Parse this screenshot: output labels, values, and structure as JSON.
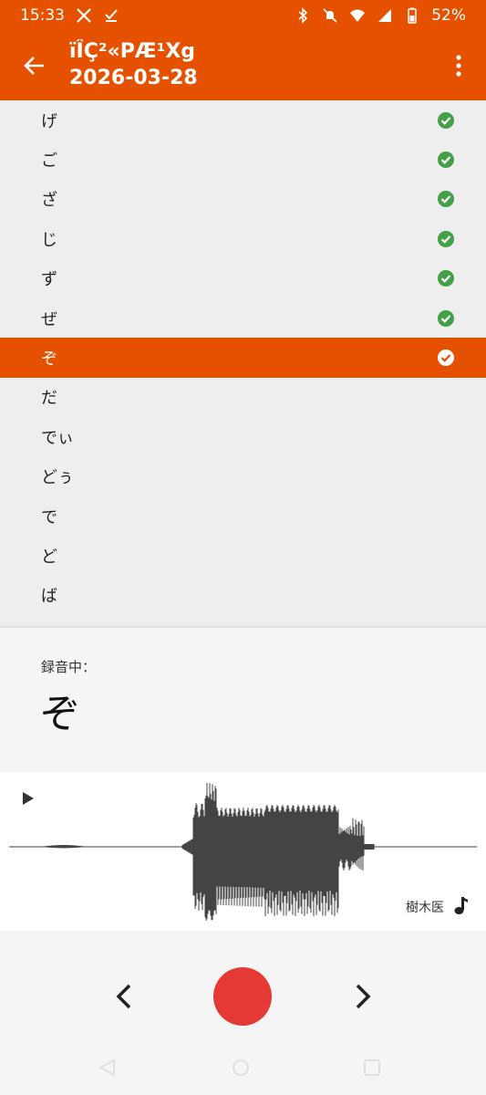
{
  "status": {
    "time": "15:33",
    "battery": "52%"
  },
  "appbar": {
    "title": "ïÎÇ²«PÆ¹Xg",
    "subtitle": "2026-03-28"
  },
  "list": {
    "items": [
      {
        "label": "げ",
        "done": true
      },
      {
        "label": "ご",
        "done": true
      },
      {
        "label": "ざ",
        "done": true
      },
      {
        "label": "じ",
        "done": true
      },
      {
        "label": "ず",
        "done": true
      },
      {
        "label": "ぜ",
        "done": true
      },
      {
        "label": "ぞ",
        "done": true
      },
      {
        "label": "だ",
        "done": false
      },
      {
        "label": "でぃ",
        "done": false
      },
      {
        "label": "どぅ",
        "done": false
      },
      {
        "label": "で",
        "done": false
      },
      {
        "label": "ど",
        "done": false
      },
      {
        "label": "ば",
        "done": false
      }
    ],
    "selected_index": 6
  },
  "recording": {
    "label": "録音中：",
    "current": "ぞ"
  },
  "waveform": {
    "speaker": "樹木医"
  },
  "colors": {
    "primary": "#e65100",
    "check": "#43a047",
    "record": "#e53935"
  }
}
